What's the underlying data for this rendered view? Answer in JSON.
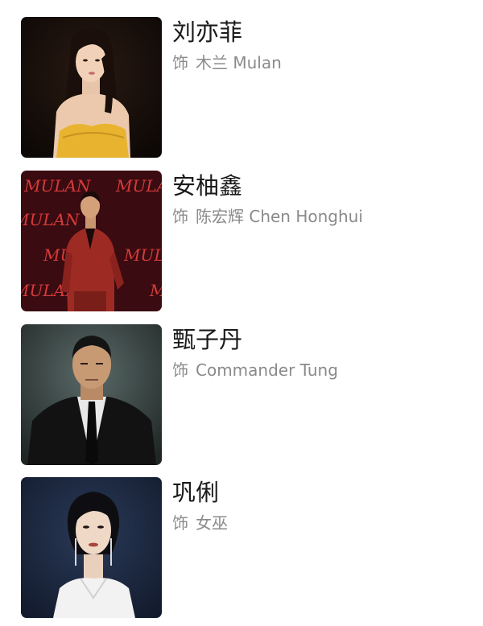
{
  "cast": [
    {
      "name": "刘亦菲",
      "role_prefix": "饰",
      "role": "木兰 Mulan",
      "photo_icon": "portrait-photo"
    },
    {
      "name": "安柚鑫",
      "role_prefix": "饰",
      "role": "陈宏辉 Chen Honghui",
      "photo_icon": "portrait-photo",
      "backdrop_text": "MULAN"
    },
    {
      "name": "甄子丹",
      "role_prefix": "饰",
      "role": "Commander Tung",
      "photo_icon": "portrait-photo"
    },
    {
      "name": "巩俐",
      "role_prefix": "饰",
      "role": "女巫",
      "photo_icon": "portrait-photo"
    }
  ],
  "colors": {
    "name_text": "#1a1a1a",
    "role_text": "#8a8a8a",
    "dress_yellow": "#e8b430",
    "suit_red": "#9e2a24",
    "backdrop_red": "#3a0b10"
  }
}
